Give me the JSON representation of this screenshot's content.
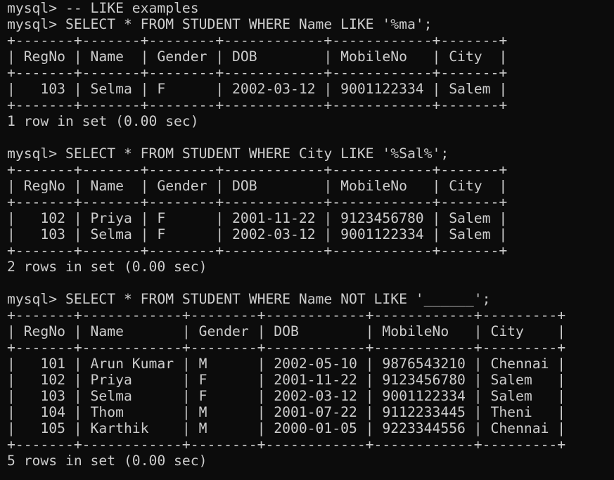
{
  "terminal": {
    "lines": [
      "mysql> -- LIKE examples",
      "mysql> SELECT * FROM STUDENT WHERE Name LIKE '%ma';",
      "+-------+-------+--------+------------+------------+-------+",
      "| RegNo | Name  | Gender | DOB        | MobileNo   | City  |",
      "+-------+-------+--------+------------+------------+-------+",
      "|   103 | Selma | F      | 2002-03-12 | 9001122334 | Salem |",
      "+-------+-------+--------+------------+------------+-------+",
      "1 row in set (0.00 sec)",
      "",
      "mysql> SELECT * FROM STUDENT WHERE City LIKE '%Sal%';",
      "+-------+-------+--------+------------+------------+-------+",
      "| RegNo | Name  | Gender | DOB        | MobileNo   | City  |",
      "+-------+-------+--------+------------+------------+-------+",
      "|   102 | Priya | F      | 2001-11-22 | 9123456780 | Salem |",
      "|   103 | Selma | F      | 2002-03-12 | 9001122334 | Salem |",
      "+-------+-------+--------+------------+------------+-------+",
      "2 rows in set (0.00 sec)",
      "",
      "mysql> SELECT * FROM STUDENT WHERE Name NOT LIKE '______';",
      "+-------+------------+--------+------------+------------+---------+",
      "| RegNo | Name       | Gender | DOB        | MobileNo   | City    |",
      "+-------+------------+--------+------------+------------+---------+",
      "|   101 | Arun Kumar | M      | 2002-05-10 | 9876543210 | Chennai |",
      "|   102 | Priya      | F      | 2001-11-22 | 9123456780 | Salem   |",
      "|   103 | Selma      | F      | 2002-03-12 | 9001122334 | Salem   |",
      "|   104 | Thom       | M      | 2001-07-22 | 9112233445 | Theni   |",
      "|   105 | Karthik    | M      | 2000-01-05 | 9223344556 | Chennai |",
      "+-------+------------+--------+------------+------------+---------+",
      "5 rows in set (0.00 sec)",
      ""
    ]
  },
  "colors": {
    "background": "#0c0c0c",
    "text": "#cccccc"
  }
}
